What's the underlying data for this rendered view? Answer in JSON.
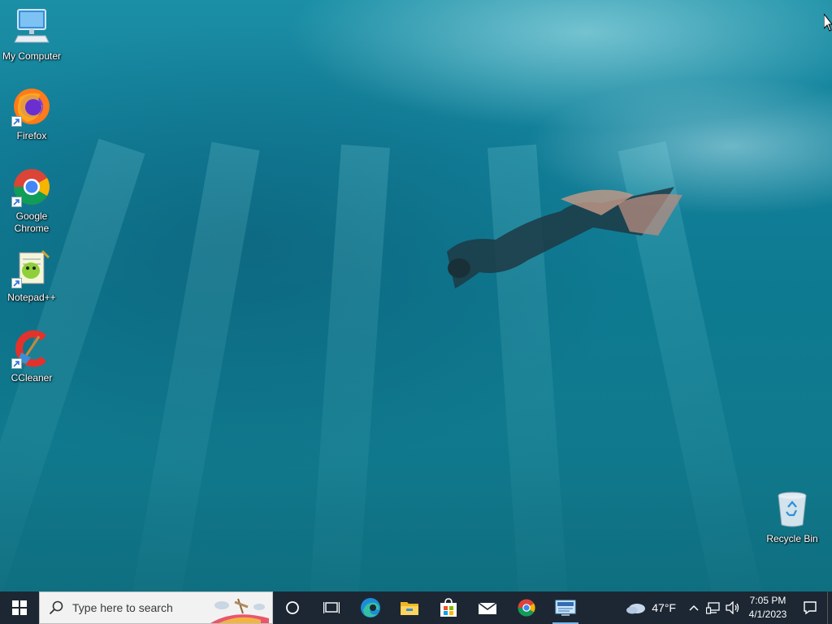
{
  "desktop": {
    "icons": [
      {
        "label": "My Computer",
        "icon": "computer-icon"
      },
      {
        "label": "Firefox",
        "icon": "firefox-icon"
      },
      {
        "label": "Google Chrome",
        "icon": "chrome-icon"
      },
      {
        "label": "Notepad++",
        "icon": "notepadpp-icon"
      },
      {
        "label": "CCleaner",
        "icon": "ccleaner-icon"
      },
      {
        "label": "Recycle Bin",
        "icon": "recycle-bin-icon"
      }
    ]
  },
  "taskbar": {
    "search_placeholder": "Type here to search",
    "pinned": [
      {
        "name": "cortana",
        "icon": "circle-icon"
      },
      {
        "name": "task-view",
        "icon": "task-view-icon"
      },
      {
        "name": "edge",
        "icon": "edge-icon"
      },
      {
        "name": "file-explorer",
        "icon": "folder-icon"
      },
      {
        "name": "store",
        "icon": "store-icon"
      },
      {
        "name": "mail",
        "icon": "mail-icon"
      },
      {
        "name": "chrome",
        "icon": "chrome-icon"
      },
      {
        "name": "rdp",
        "icon": "remote-desktop-icon",
        "active": true
      }
    ],
    "weather": {
      "temperature": "47°F",
      "icon": "cloud-icon"
    },
    "clock": {
      "time": "7:05 PM",
      "date": "4/1/2023"
    }
  },
  "colors": {
    "taskbar": "#1c2733",
    "accent": "#7ab8e8",
    "water": "#10798d"
  }
}
